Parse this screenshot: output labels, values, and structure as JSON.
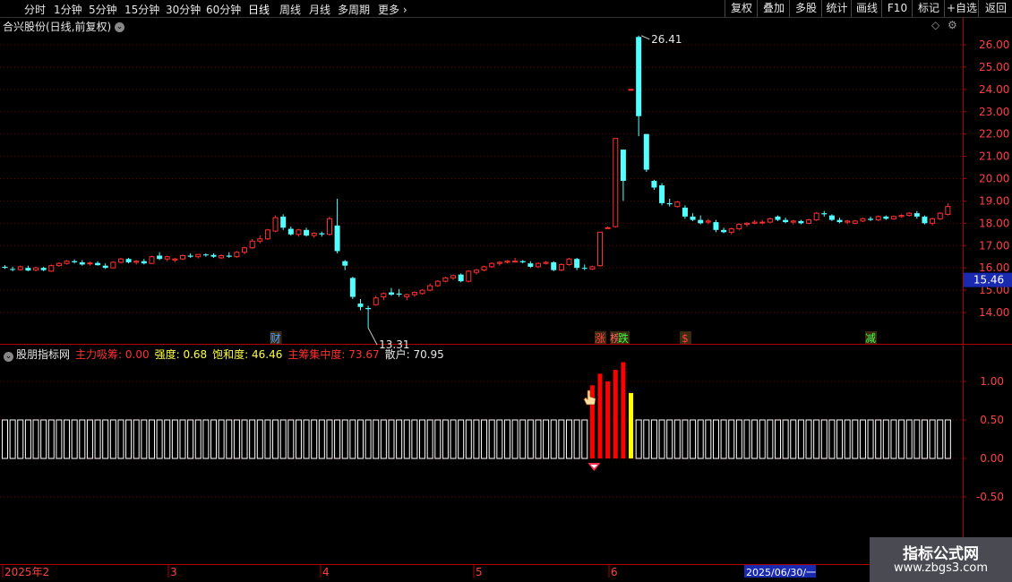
{
  "toolbar": {
    "periods": [
      "分时",
      "1分钟",
      "5分钟",
      "15分钟",
      "30分钟",
      "60分钟",
      "日线",
      "周线",
      "月线",
      "多周期",
      "更多"
    ],
    "active_period": "日线",
    "right_buttons": [
      "复权",
      "叠加",
      "多股",
      "统计",
      "画线",
      "F10",
      "+自选",
      "返回"
    ],
    "right_extra": "标记"
  },
  "main_title": "合兴股份(日线,前复权)",
  "indicator": {
    "name": "股朋指标网",
    "items": [
      {
        "label": "主力吸筹:",
        "value": "0.00",
        "color": "#ff3030"
      },
      {
        "label": "强度:",
        "value": "0.68",
        "color": "#ffff40"
      },
      {
        "label": "饱和度:",
        "value": "46.46",
        "color": "#ffff40"
      },
      {
        "label": "主筹集中度:",
        "value": "73.67",
        "color": "#ff3030"
      },
      {
        "label": "散户:",
        "value": "70.95",
        "color": "#e6e6e6"
      }
    ]
  },
  "chart_data": [
    {
      "type": "candlestick",
      "title": "合兴股份(日线,前复权)",
      "ylim": [
        13.3,
        26.7
      ],
      "y_ticks": [
        "14.00",
        "15.00",
        "16.00",
        "17.00",
        "18.00",
        "19.00",
        "20.00",
        "21.00",
        "22.00",
        "23.00",
        "24.00",
        "25.00",
        "26.00"
      ],
      "current_price": "15.46",
      "max_label": "26.41",
      "min_label": "13.31",
      "x_axis_labels": [
        "2025年2",
        "3",
        "4",
        "5",
        "6",
        "2025/06/30/一"
      ],
      "event_markers": [
        {
          "text": "财",
          "color": "#4aa0ff",
          "at": 35
        },
        {
          "text": "涨",
          "color": "#ff4040",
          "at": 77
        },
        {
          "text": "榜",
          "color": "#ff6060",
          "at": 79
        },
        {
          "text": "跌",
          "color": "#40ff40",
          "at": 80
        },
        {
          "text": "$",
          "color": "#ff4040",
          "at": 88
        },
        {
          "text": "减",
          "color": "#40ff40",
          "at": 112
        }
      ],
      "candles": [
        {
          "o": 16.05,
          "h": 16.12,
          "l": 15.95,
          "c": 16.0
        },
        {
          "o": 15.95,
          "h": 16.05,
          "l": 15.85,
          "c": 15.92
        },
        {
          "o": 15.92,
          "h": 16.1,
          "l": 15.88,
          "c": 16.05
        },
        {
          "o": 16.0,
          "h": 16.1,
          "l": 15.85,
          "c": 15.88
        },
        {
          "o": 15.9,
          "h": 16.05,
          "l": 15.85,
          "c": 16.0
        },
        {
          "o": 16.0,
          "h": 16.05,
          "l": 15.85,
          "c": 15.9
        },
        {
          "o": 15.85,
          "h": 16.15,
          "l": 15.82,
          "c": 16.1
        },
        {
          "o": 16.1,
          "h": 16.25,
          "l": 16.05,
          "c": 16.2
        },
        {
          "o": 16.2,
          "h": 16.35,
          "l": 16.15,
          "c": 16.3
        },
        {
          "o": 16.3,
          "h": 16.38,
          "l": 16.2,
          "c": 16.25
        },
        {
          "o": 16.25,
          "h": 16.35,
          "l": 16.1,
          "c": 16.15
        },
        {
          "o": 16.2,
          "h": 16.28,
          "l": 16.1,
          "c": 16.22
        },
        {
          "o": 16.22,
          "h": 16.3,
          "l": 16.1,
          "c": 16.12
        },
        {
          "o": 16.1,
          "h": 16.2,
          "l": 15.95,
          "c": 16.0
        },
        {
          "o": 16.0,
          "h": 16.3,
          "l": 15.98,
          "c": 16.25
        },
        {
          "o": 16.25,
          "h": 16.45,
          "l": 16.2,
          "c": 16.4
        },
        {
          "o": 16.4,
          "h": 16.45,
          "l": 16.2,
          "c": 16.25
        },
        {
          "o": 16.25,
          "h": 16.35,
          "l": 16.15,
          "c": 16.3
        },
        {
          "o": 16.3,
          "h": 16.4,
          "l": 16.15,
          "c": 16.2
        },
        {
          "o": 16.2,
          "h": 16.55,
          "l": 16.18,
          "c": 16.5
        },
        {
          "o": 16.55,
          "h": 16.7,
          "l": 16.35,
          "c": 16.4
        },
        {
          "o": 16.4,
          "h": 16.55,
          "l": 16.3,
          "c": 16.5
        },
        {
          "o": 16.35,
          "h": 16.45,
          "l": 16.25,
          "c": 16.4
        },
        {
          "o": 16.4,
          "h": 16.6,
          "l": 16.35,
          "c": 16.55
        },
        {
          "o": 16.55,
          "h": 16.65,
          "l": 16.45,
          "c": 16.5
        },
        {
          "o": 16.5,
          "h": 16.62,
          "l": 16.42,
          "c": 16.6
        },
        {
          "o": 16.6,
          "h": 16.65,
          "l": 16.5,
          "c": 16.58
        },
        {
          "o": 16.58,
          "h": 16.65,
          "l": 16.45,
          "c": 16.5
        },
        {
          "o": 16.45,
          "h": 16.6,
          "l": 16.4,
          "c": 16.55
        },
        {
          "o": 16.55,
          "h": 16.7,
          "l": 16.45,
          "c": 16.5
        },
        {
          "o": 16.5,
          "h": 16.75,
          "l": 16.45,
          "c": 16.7
        },
        {
          "o": 16.7,
          "h": 16.95,
          "l": 16.6,
          "c": 16.9
        },
        {
          "o": 16.9,
          "h": 17.3,
          "l": 16.85,
          "c": 17.2
        },
        {
          "o": 17.2,
          "h": 17.45,
          "l": 17.1,
          "c": 17.3
        },
        {
          "o": 17.3,
          "h": 17.75,
          "l": 17.25,
          "c": 17.7
        },
        {
          "o": 17.65,
          "h": 18.35,
          "l": 17.6,
          "c": 18.25
        },
        {
          "o": 18.3,
          "h": 18.4,
          "l": 17.7,
          "c": 17.8
        },
        {
          "o": 17.75,
          "h": 17.85,
          "l": 17.45,
          "c": 17.5
        },
        {
          "o": 17.5,
          "h": 17.75,
          "l": 17.4,
          "c": 17.7
        },
        {
          "o": 17.7,
          "h": 17.8,
          "l": 17.4,
          "c": 17.45
        },
        {
          "o": 17.45,
          "h": 17.6,
          "l": 17.35,
          "c": 17.55
        },
        {
          "o": 17.55,
          "h": 17.62,
          "l": 17.4,
          "c": 17.5
        },
        {
          "o": 17.5,
          "h": 18.3,
          "l": 17.45,
          "c": 18.2
        },
        {
          "o": 17.9,
          "h": 19.1,
          "l": 16.65,
          "c": 16.75
        },
        {
          "o": 16.3,
          "h": 16.35,
          "l": 15.9,
          "c": 16.1
        },
        {
          "o": 15.55,
          "h": 15.6,
          "l": 14.6,
          "c": 14.7
        },
        {
          "o": 14.4,
          "h": 14.6,
          "l": 14.1,
          "c": 14.25
        },
        {
          "o": 14.2,
          "h": 14.3,
          "l": 13.31,
          "c": 14.15
        },
        {
          "o": 14.35,
          "h": 14.75,
          "l": 14.3,
          "c": 14.65
        },
        {
          "o": 14.7,
          "h": 14.9,
          "l": 14.55,
          "c": 14.85
        },
        {
          "o": 14.9,
          "h": 15.1,
          "l": 14.75,
          "c": 14.8
        },
        {
          "o": 14.85,
          "h": 15.05,
          "l": 14.7,
          "c": 14.8
        },
        {
          "o": 14.7,
          "h": 14.85,
          "l": 14.55,
          "c": 14.8
        },
        {
          "o": 14.8,
          "h": 14.95,
          "l": 14.7,
          "c": 14.9
        },
        {
          "o": 14.85,
          "h": 15.05,
          "l": 14.8,
          "c": 15.0
        },
        {
          "o": 15.0,
          "h": 15.3,
          "l": 14.95,
          "c": 15.2
        },
        {
          "o": 15.2,
          "h": 15.45,
          "l": 15.15,
          "c": 15.4
        },
        {
          "o": 15.4,
          "h": 15.6,
          "l": 15.35,
          "c": 15.55
        },
        {
          "o": 15.55,
          "h": 15.7,
          "l": 15.45,
          "c": 15.65
        },
        {
          "o": 15.7,
          "h": 15.75,
          "l": 15.35,
          "c": 15.4
        },
        {
          "o": 15.4,
          "h": 15.9,
          "l": 15.35,
          "c": 15.85
        },
        {
          "o": 15.8,
          "h": 15.95,
          "l": 15.7,
          "c": 15.9
        },
        {
          "o": 15.9,
          "h": 16.1,
          "l": 15.85,
          "c": 16.05
        },
        {
          "o": 16.05,
          "h": 16.25,
          "l": 16.0,
          "c": 16.2
        },
        {
          "o": 16.2,
          "h": 16.3,
          "l": 16.1,
          "c": 16.25
        },
        {
          "o": 16.25,
          "h": 16.35,
          "l": 16.2,
          "c": 16.3
        },
        {
          "o": 16.3,
          "h": 16.45,
          "l": 16.25,
          "c": 16.3
        },
        {
          "o": 16.3,
          "h": 16.35,
          "l": 16.2,
          "c": 16.25
        },
        {
          "o": 16.2,
          "h": 16.3,
          "l": 16.0,
          "c": 16.05
        },
        {
          "o": 16.05,
          "h": 16.25,
          "l": 16.0,
          "c": 16.2
        },
        {
          "o": 16.2,
          "h": 16.3,
          "l": 16.15,
          "c": 16.25
        },
        {
          "o": 16.25,
          "h": 16.3,
          "l": 15.85,
          "c": 15.9
        },
        {
          "o": 15.9,
          "h": 16.2,
          "l": 15.85,
          "c": 16.15
        },
        {
          "o": 16.15,
          "h": 16.45,
          "l": 16.1,
          "c": 16.4
        },
        {
          "o": 16.4,
          "h": 16.45,
          "l": 15.9,
          "c": 16.0
        },
        {
          "o": 16.0,
          "h": 16.15,
          "l": 15.9,
          "c": 15.98
        },
        {
          "o": 15.95,
          "h": 16.1,
          "l": 15.9,
          "c": 16.05
        },
        {
          "o": 16.1,
          "h": 17.6,
          "l": 16.05,
          "c": 17.6
        },
        {
          "o": 17.8,
          "h": 17.85,
          "l": 17.8,
          "c": 17.8
        },
        {
          "o": 17.85,
          "h": 21.8,
          "l": 17.8,
          "c": 21.8
        },
        {
          "o": 21.3,
          "h": 21.3,
          "l": 19.0,
          "c": 19.9
        },
        {
          "o": 24.0,
          "h": 24.0,
          "l": 24.0,
          "c": 24.0
        },
        {
          "o": 26.35,
          "h": 26.41,
          "l": 21.9,
          "c": 22.8
        },
        {
          "o": 22.0,
          "h": 22.0,
          "l": 20.3,
          "c": 20.4
        },
        {
          "o": 19.9,
          "h": 19.95,
          "l": 19.5,
          "c": 19.6
        },
        {
          "o": 19.7,
          "h": 19.8,
          "l": 18.8,
          "c": 18.9
        },
        {
          "o": 18.9,
          "h": 19.1,
          "l": 18.75,
          "c": 18.85
        },
        {
          "o": 18.75,
          "h": 19.0,
          "l": 18.7,
          "c": 18.95
        },
        {
          "o": 18.7,
          "h": 18.8,
          "l": 18.2,
          "c": 18.3
        },
        {
          "o": 18.3,
          "h": 18.45,
          "l": 18.1,
          "c": 18.15
        },
        {
          "o": 18.15,
          "h": 18.35,
          "l": 17.95,
          "c": 18.0
        },
        {
          "o": 18.05,
          "h": 18.2,
          "l": 17.95,
          "c": 18.1
        },
        {
          "o": 18.05,
          "h": 18.15,
          "l": 17.6,
          "c": 17.7
        },
        {
          "o": 17.7,
          "h": 17.8,
          "l": 17.55,
          "c": 17.6
        },
        {
          "o": 17.6,
          "h": 17.8,
          "l": 17.5,
          "c": 17.75
        },
        {
          "o": 17.75,
          "h": 18.0,
          "l": 17.7,
          "c": 17.95
        },
        {
          "o": 17.95,
          "h": 18.05,
          "l": 17.85,
          "c": 18.0
        },
        {
          "o": 18.0,
          "h": 18.15,
          "l": 17.95,
          "c": 18.05
        },
        {
          "o": 18.05,
          "h": 18.15,
          "l": 17.95,
          "c": 18.05
        },
        {
          "o": 18.05,
          "h": 18.25,
          "l": 18.0,
          "c": 18.2
        },
        {
          "o": 18.3,
          "h": 18.35,
          "l": 18.1,
          "c": 18.15
        },
        {
          "o": 18.15,
          "h": 18.25,
          "l": 18.0,
          "c": 18.05
        },
        {
          "o": 18.05,
          "h": 18.15,
          "l": 17.95,
          "c": 18.1
        },
        {
          "o": 18.1,
          "h": 18.15,
          "l": 17.95,
          "c": 18.0
        },
        {
          "o": 18.0,
          "h": 18.2,
          "l": 17.95,
          "c": 18.15
        },
        {
          "o": 18.15,
          "h": 18.5,
          "l": 18.1,
          "c": 18.45
        },
        {
          "o": 18.45,
          "h": 18.55,
          "l": 18.3,
          "c": 18.4
        },
        {
          "o": 18.35,
          "h": 18.4,
          "l": 18.1,
          "c": 18.15
        },
        {
          "o": 18.15,
          "h": 18.25,
          "l": 18.0,
          "c": 18.05
        },
        {
          "o": 18.05,
          "h": 18.15,
          "l": 17.95,
          "c": 18.1
        },
        {
          "o": 18.0,
          "h": 18.15,
          "l": 17.95,
          "c": 18.1
        },
        {
          "o": 18.1,
          "h": 18.25,
          "l": 18.05,
          "c": 18.2
        },
        {
          "o": 18.2,
          "h": 18.3,
          "l": 18.1,
          "c": 18.15
        },
        {
          "o": 18.15,
          "h": 18.35,
          "l": 18.1,
          "c": 18.3
        },
        {
          "o": 18.3,
          "h": 18.35,
          "l": 18.15,
          "c": 18.2
        },
        {
          "o": 18.2,
          "h": 18.35,
          "l": 18.15,
          "c": 18.3
        },
        {
          "o": 18.3,
          "h": 18.4,
          "l": 18.25,
          "c": 18.35
        },
        {
          "o": 18.35,
          "h": 18.5,
          "l": 18.3,
          "c": 18.45
        },
        {
          "o": 18.45,
          "h": 18.55,
          "l": 18.2,
          "c": 18.3
        },
        {
          "o": 18.3,
          "h": 18.35,
          "l": 17.95,
          "c": 18.0
        },
        {
          "o": 18.0,
          "h": 18.25,
          "l": 17.9,
          "c": 18.2
        },
        {
          "o": 18.2,
          "h": 18.5,
          "l": 18.15,
          "c": 18.45
        },
        {
          "o": 18.4,
          "h": 18.9,
          "l": 18.35,
          "c": 18.75
        }
      ]
    },
    {
      "type": "bar",
      "ylim": [
        -1.3,
        1.3
      ],
      "y_ticks": [
        "1.00",
        "0.50",
        "0.00",
        "-0.50"
      ],
      "baseline_value": 0.5,
      "highlighted": [
        {
          "index": 76,
          "value": 0.95,
          "color": "#ff0000"
        },
        {
          "index": 77,
          "value": 1.1,
          "color": "#ff0000"
        },
        {
          "index": 78,
          "value": 1.0,
          "color": "#ff0000"
        },
        {
          "index": 79,
          "value": 1.15,
          "color": "#ff0000"
        },
        {
          "index": 80,
          "value": 1.25,
          "color": "#ff0000"
        },
        {
          "index": 81,
          "value": 0.85,
          "color": "#ffff00"
        }
      ]
    }
  ],
  "watermark": {
    "line1": "指标公式网",
    "line2": "www.zbgs3.com"
  }
}
